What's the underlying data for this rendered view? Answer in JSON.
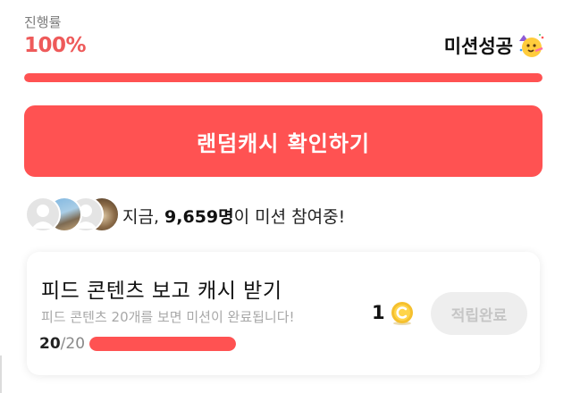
{
  "progress": {
    "label": "진행률",
    "value_text": "100%",
    "fraction": 1.0
  },
  "mission": {
    "status_label": "미션성공",
    "status_icon": "party-face-icon"
  },
  "cta": {
    "label": "랜덤캐시 확인하기"
  },
  "participants": {
    "prefix": "지금, ",
    "count": "9,659명",
    "suffix": "이 미션 참여중!",
    "avatars": [
      "default-avatar-icon",
      "avatar-photo",
      "default-avatar-icon",
      "avatar-photo"
    ]
  },
  "task": {
    "title": "피드 콘텐츠 보고 캐시 받기",
    "description": "피드 콘텐츠 20개를 보면 미션이 완료됩니다!",
    "done": "20",
    "total": "/20",
    "fraction": 1.0,
    "reward_amount": "1",
    "reward_icon": "coin-icon",
    "button_label": "적립완료"
  },
  "colors": {
    "accent": "#ff5252",
    "progress_text": "#ee5a5a",
    "disabled_bg": "#eeeeee",
    "disabled_text": "#c6c6c6",
    "coin": "#f5c02e"
  }
}
